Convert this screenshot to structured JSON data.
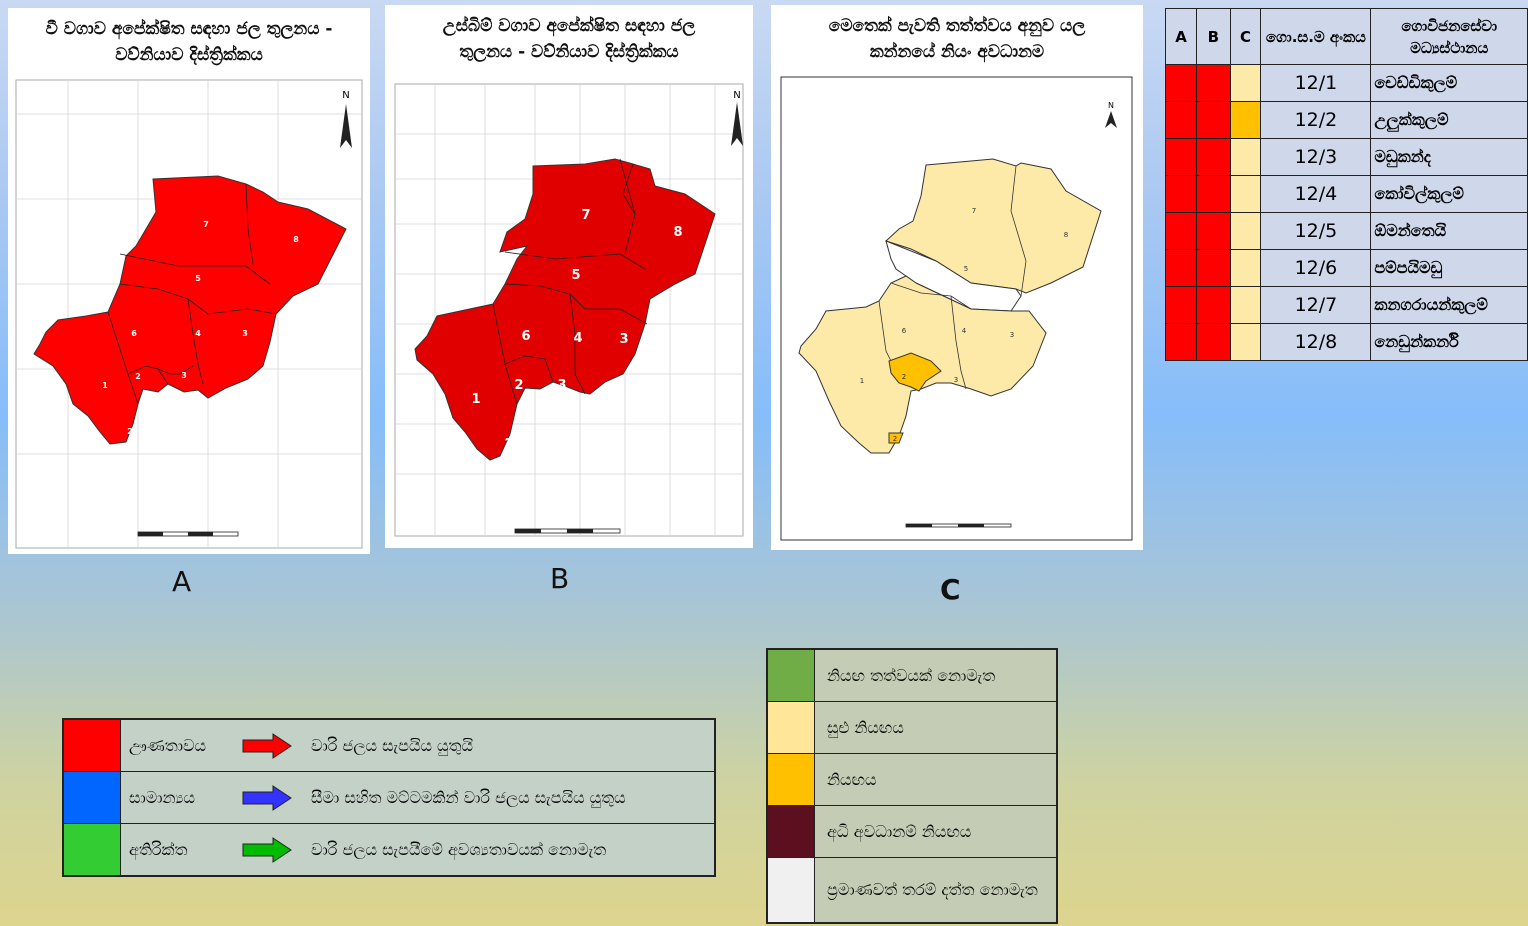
{
  "panels": [
    {
      "letter": "A",
      "title_line1": "වී වගාව අපේක්ෂිත සඳහා ජල තුලනය -",
      "title_line2": "වව්නියාව දිස්ත්‍රික්කය"
    },
    {
      "letter": "B",
      "title_line1": "උස්බිම් වගාව  අපේක්ෂිත සඳහා ජල",
      "title_line2": "තුලනය - වව්නියාව දිස්ත්‍රික්කය"
    },
    {
      "letter": "C",
      "title_line1": "මෙතෙක් පැවති තත්ත්වය අනුව යල",
      "title_line2": "කන්නයේ නියං අවධානම"
    }
  ],
  "map_labels": [
    "1",
    "2",
    "2",
    "3",
    "3",
    "4",
    "5",
    "6",
    "7",
    "8"
  ],
  "north": "N",
  "table": {
    "headers": {
      "a": "A",
      "b": "B",
      "c": "C",
      "num": "ගො.ස.ම අංකය",
      "name": "ගොවිජනසේවා මධ්‍යස්ථානය"
    },
    "rows": [
      {
        "num": "12/1",
        "name": "චෙඩ්ඩිකුලම්",
        "a": "#ff0000",
        "b": "#ff0000",
        "c": "#fde9a8"
      },
      {
        "num": "12/2",
        "name": "උලුක්කුලම්",
        "a": "#ff0000",
        "b": "#ff0000",
        "c": "#ffc000"
      },
      {
        "num": "12/3",
        "name": "මඩුකන්ද",
        "a": "#ff0000",
        "b": "#ff0000",
        "c": "#fde9a8"
      },
      {
        "num": "12/4",
        "name": "කෝවිල්කුලම්",
        "a": "#ff0000",
        "b": "#ff0000",
        "c": "#fde9a8"
      },
      {
        "num": "12/5",
        "name": "ඕමන්තෙයි",
        "a": "#ff0000",
        "b": "#ff0000",
        "c": "#fde9a8"
      },
      {
        "num": "12/6",
        "name": "පම්පයිමඩු",
        "a": "#ff0000",
        "b": "#ff0000",
        "c": "#fde9a8"
      },
      {
        "num": "12/7",
        "name": "කනගරායන්කුලම්",
        "a": "#ff0000",
        "b": "#ff0000",
        "c": "#fde9a8"
      },
      {
        "num": "12/8",
        "name": "නෙඩුන්කර්නි",
        "a": "#ff0000",
        "b": "#ff0000",
        "c": "#fde9a8"
      }
    ]
  },
  "legend_balance": [
    {
      "color": "#ff0000",
      "arrow_color": "#ff0000",
      "label": "ඌණතාවය",
      "desc": "වාරි ජලය සැපයිය යුතුයි"
    },
    {
      "color": "#0066ff",
      "arrow_color": "#3333ff",
      "label": "සාමාන්‍යය",
      "desc": "සීමා සහිත මට්ටමකින් වාරි ජලය සැපයිය යුතුය"
    },
    {
      "color": "#33cc33",
      "arrow_color": "#00bb00",
      "label": "අතිරික්ත",
      "desc": "වාරි ජලය සැපයීමේ අවශ්‍යතාවයක් නොමැත"
    }
  ],
  "legend_drought": [
    {
      "color": "#70ad47",
      "label": "නියඟ තත්වයක් නොමැත"
    },
    {
      "color": "#ffe699",
      "label": "සුළු නියඟය"
    },
    {
      "color": "#ffc000",
      "label": "නියඟය"
    },
    {
      "color": "#5c0f1e",
      "label": "අධි අවධානම් නියඟය"
    },
    {
      "color": "#f0f0f0",
      "label": "ප්‍රමාණවත් තරම් දත්ත නොමැත"
    }
  ]
}
